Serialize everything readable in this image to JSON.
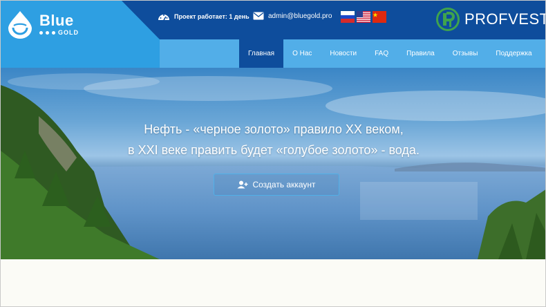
{
  "header": {
    "logo": {
      "name": "Blue",
      "sub": "GOLD"
    },
    "uptime": {
      "icon": "speedometer-icon",
      "text": "Проект работает: 1 день"
    },
    "email": {
      "icon": "envelope-icon",
      "text": "admin@bluegold.pro"
    },
    "flags": [
      {
        "icon": "russia-flag-icon"
      },
      {
        "icon": "usa-flag-icon"
      },
      {
        "icon": "china-flag-icon"
      }
    ],
    "brand": {
      "icon": "profvest-logo-icon",
      "text": "PROFVEST"
    }
  },
  "nav": {
    "items": [
      {
        "label": "Главная",
        "active": true
      },
      {
        "label": "О Нас"
      },
      {
        "label": "Новости"
      },
      {
        "label": "FAQ"
      },
      {
        "label": "Правила"
      },
      {
        "label": "Отзывы"
      },
      {
        "label": "Поддержка"
      }
    ]
  },
  "hero": {
    "line1": "Нефть - «черное золото» правило XX веком,",
    "line2": "в XXI веке править будет «голубое золото» - вода.",
    "cta": {
      "icon": "add-user-icon",
      "label": "Создать аккаунт"
    }
  },
  "colors": {
    "topbar": "#0e4d9c",
    "navbar": "#52aee8",
    "logo_panel": "#2e9fe2",
    "cta_border": "#4fb0e8"
  }
}
